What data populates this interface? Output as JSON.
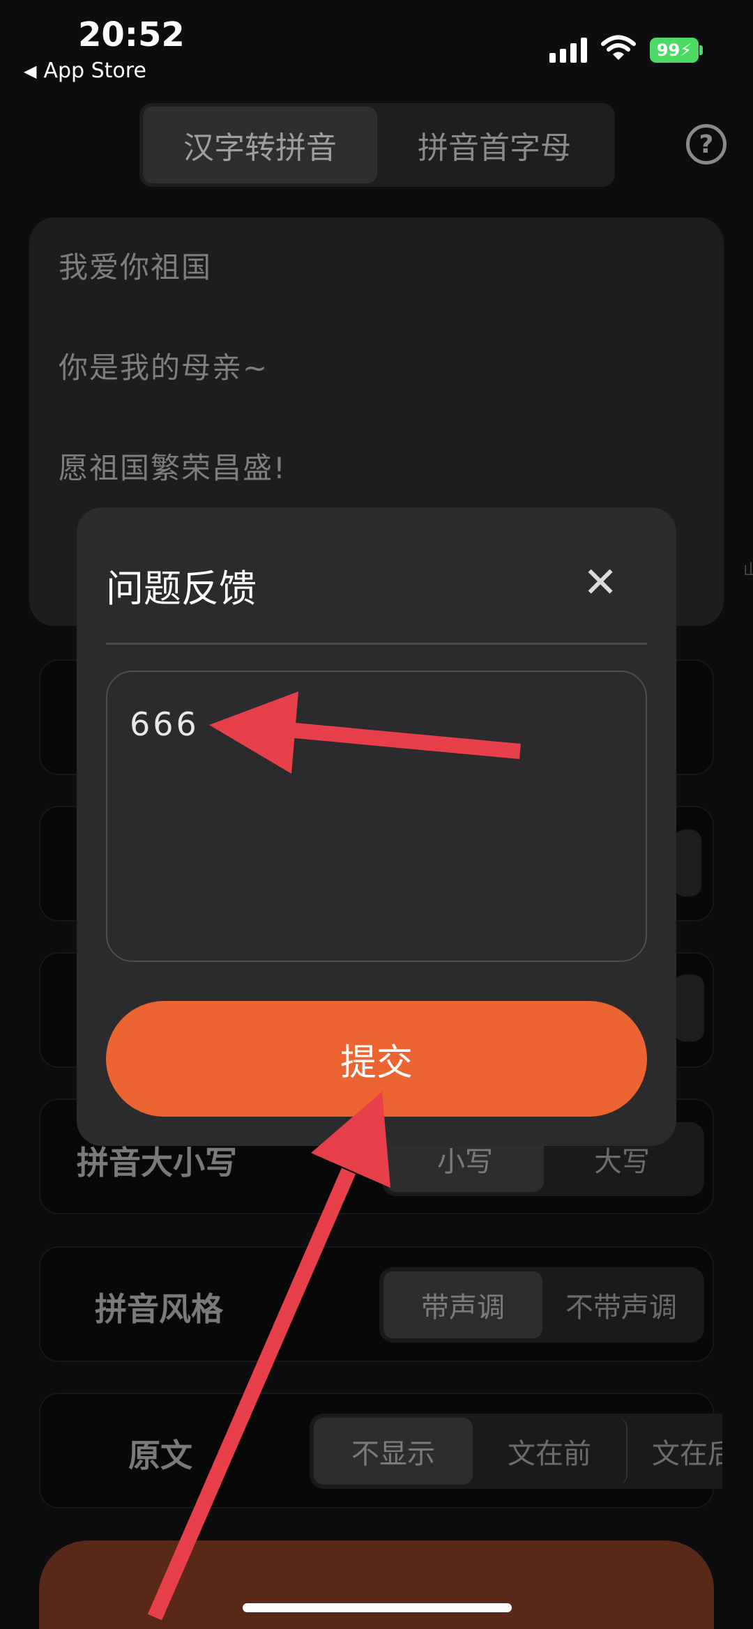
{
  "status_bar": {
    "time": "20:52",
    "back_label": "App Store",
    "battery": "99"
  },
  "top_tabs": [
    {
      "label": "汉字转拼音",
      "active": true
    },
    {
      "label": "拼音首字母",
      "active": false
    }
  ],
  "help_icon": "?",
  "input_lines": [
    "我爱你祖国",
    "你是我的母亲~",
    "愿祖国繁荣昌盛!"
  ],
  "settings": {
    "case": {
      "label": "拼音大小写",
      "options": [
        "小写",
        "大写"
      ],
      "selected": "小写"
    },
    "style": {
      "label": "拼音风格",
      "options": [
        "带声调",
        "不带声调"
      ],
      "selected": "带声调"
    },
    "original": {
      "label": "原文",
      "options": [
        "不显示",
        "文在前",
        "文在后"
      ],
      "selected": "不显示"
    }
  },
  "feedback_modal": {
    "title": "问题反馈",
    "close_glyph": "✕",
    "text_value": "666",
    "submit_label": "提交"
  },
  "colors": {
    "accent": "#ec6432",
    "annotation_arrow": "#e8404a",
    "modal_bg": "#2b2b2d"
  }
}
